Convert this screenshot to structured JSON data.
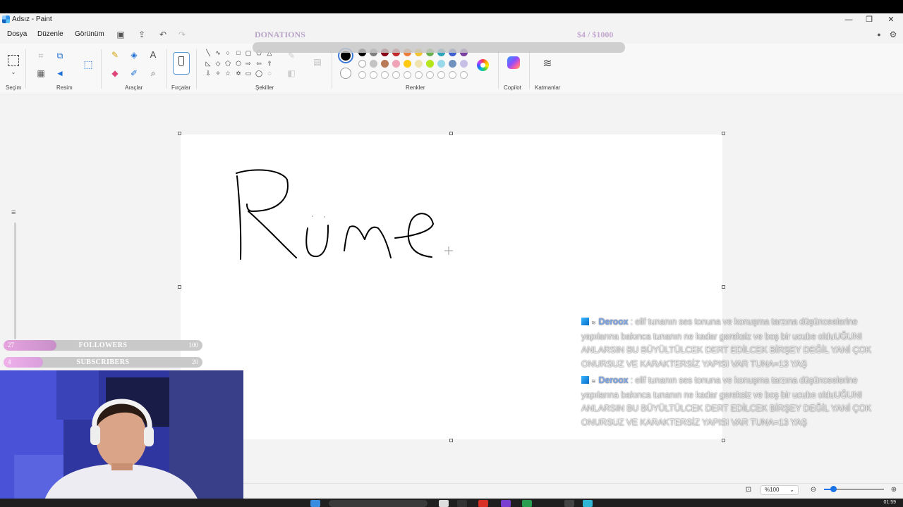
{
  "window": {
    "title": "Adsız - Paint",
    "controls": [
      "—",
      "❐",
      "✕"
    ]
  },
  "menu": [
    "Dosya",
    "Düzenle",
    "Görünüm"
  ],
  "overlay": {
    "donations_label": "DONATIONS",
    "donations_amount": "$4  / $1000",
    "followers": {
      "current": "27",
      "label": "FOLLOWERS",
      "goal": "100",
      "progress": 0.27
    },
    "subscribers": {
      "current": "4",
      "label": "SUBSCRIBERS",
      "goal": "20",
      "progress": 0.2
    }
  },
  "ribbon": {
    "groups": [
      "Seçim",
      "Resim",
      "Araçlar",
      "Fırçalar",
      "Şekiller",
      "Renkler",
      "Copilot",
      "Katmanlar"
    ]
  },
  "colors": {
    "primary": "#000000",
    "row1": [
      "#000000",
      "#7f7f7f",
      "#880015",
      "#c3282b",
      "#ed7f3c",
      "#f2c530",
      "#6ab04c",
      "#2ea4b9",
      "#3f5fd0",
      "#7a3fa0"
    ],
    "row2": [
      "#ffffff",
      "#c3c3c3",
      "#b97a57",
      "#f0a2b6",
      "#ffc90e",
      "#efe4b0",
      "#b5e61d",
      "#99d9ea",
      "#7092be",
      "#c8bfe7"
    ]
  },
  "status": {
    "zoom": "%100"
  },
  "taskbar": {
    "time": "01:59"
  },
  "chat": [
    {
      "user": "Deroox",
      "message": ": elif tunanın ses tonuna ve konuşma tarzına düşünceelerine yapılarına bakınca tunanın ne kadar gereksiz ve boş bir ucube olduUĞUNI ANLARSIN BU BÜYÜLTÜLCEK DERT EDİLCEK BİRŞEY DEĞİL YANİ ÇOK ONURSUZ VE KARAKTERSİZ YAPISI VAR TUNA=13 YAŞ"
    },
    {
      "user": "Deroox",
      "message": ": elif tunanın ses tonuna ve konuşma tarzına düşünceelerine yapılarına bakınca tunanın ne kadar gereksiz ve boş bir ucube olduUĞUNI ANLARSIN BU BÜYÜLTÜLCEK DERT EDİLCEK BİRŞEY DEĞİL YANİ ÇOK ONURSUZ VE KARAKTERSİZ YAPISI VAR TUNA=13 YAŞ"
    }
  ]
}
